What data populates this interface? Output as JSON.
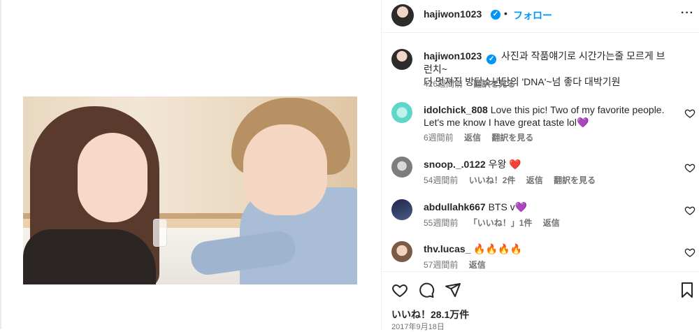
{
  "post": {
    "owner": "hajiwon1023",
    "follow_label": "フォロー",
    "caption_line1": "사진과 작품얘기로 시간가는줄 모르게 브런치~",
    "caption_line2": "더 멋져진 방탄소년단의 'DNA'~넘 좋다 대박기원",
    "caption_meta_time": "426週間前",
    "caption_meta_translate": "翻訳を見る",
    "likes_label": "いいね！28.1万件",
    "date": "2017年9月18日"
  },
  "comments": [
    {
      "user": "idolchick_808",
      "text": "Love this pic! Two of my favorite people. Let's me know I have great taste lol",
      "emoji": "💜",
      "time": "6週間前",
      "reply": "返信",
      "translate": "翻訳を見る"
    },
    {
      "user": "snoop._.0122",
      "text": "우왕",
      "emoji": "❤️",
      "time": "54週間前",
      "likes": "いいね！2件",
      "reply": "返信",
      "translate": "翻訳を見る"
    },
    {
      "user": "abdullahk667",
      "text": "BTS v",
      "emoji": "💜",
      "time": "55週間前",
      "likes": "「いいね！」1件",
      "reply": "返信"
    },
    {
      "user": "thv.lucas_",
      "text": "🔥🔥🔥🔥",
      "time": "57週間前",
      "reply": "返信"
    }
  ],
  "colors": {
    "accent": "#0095f6",
    "text": "#262626",
    "muted": "#737373"
  },
  "icons": [
    "verified-badge-icon",
    "more-options-icon",
    "heart-icon",
    "comment-icon",
    "share-icon",
    "bookmark-icon"
  ]
}
